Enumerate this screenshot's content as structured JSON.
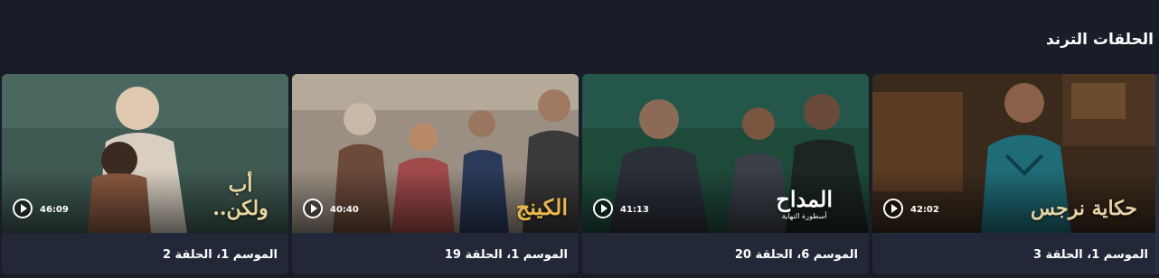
{
  "section": {
    "title": "الحلقات الترند"
  },
  "cards": [
    {
      "title": "الموسم 1، الحلقة 3",
      "duration": "42:02",
      "logo": "حكاية نرجس",
      "logo_sub": "",
      "logo_color": "#e7d2a2",
      "colors": {
        "bg": "#3a2a1c",
        "accent": "#1f6c78"
      }
    },
    {
      "title": "الموسم 6، الحلقة 20",
      "duration": "41:13",
      "logo": "المداح",
      "logo_sub": "أسطورة النهاية",
      "logo_color": "#ffffff",
      "colors": {
        "bg": "#1e4a3a",
        "accent": "#2b2f38"
      }
    },
    {
      "title": "الموسم 1، الحلقة 19",
      "duration": "40:40",
      "logo": "الكينج",
      "logo_sub": "",
      "logo_color": "#e8b84a",
      "colors": {
        "bg": "#9a8f82",
        "accent": "#6b4a3a"
      }
    },
    {
      "title": "الموسم 1، الحلقة 2",
      "duration": "46:09",
      "logo": "أب ولكن..",
      "logo_sub": "",
      "logo_color": "#e8d7a0",
      "colors": {
        "bg": "#3f5a52",
        "accent": "#d8cfc2"
      }
    }
  ]
}
